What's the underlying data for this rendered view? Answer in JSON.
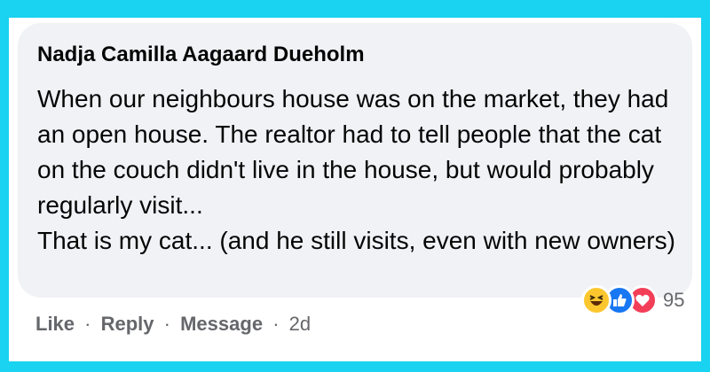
{
  "comment": {
    "author": "Nadja Camilla Aagaard Dueholm",
    "lines": [
      "When our neighbours house was on the market, they had",
      "an open house. The realtor had to tell people that the cat",
      "on the couch didn't live in the house, but would probably",
      "regularly visit...",
      "That is my cat... (and he still visits, even with new owners)"
    ],
    "reactions": {
      "icons": [
        "haha-icon",
        "like-icon",
        "love-icon"
      ],
      "count": "95"
    },
    "actions": {
      "like": "Like",
      "reply": "Reply",
      "message": "Message",
      "separator": "·",
      "time": "2d"
    }
  },
  "colors": {
    "frame": "#19d3f0",
    "bubble": "#f0f2f5",
    "text": "#050505",
    "muted": "#65676b",
    "like_blue": "#1877f2",
    "love_red": "#f33e58",
    "haha_yellow": "#fcc72e"
  }
}
